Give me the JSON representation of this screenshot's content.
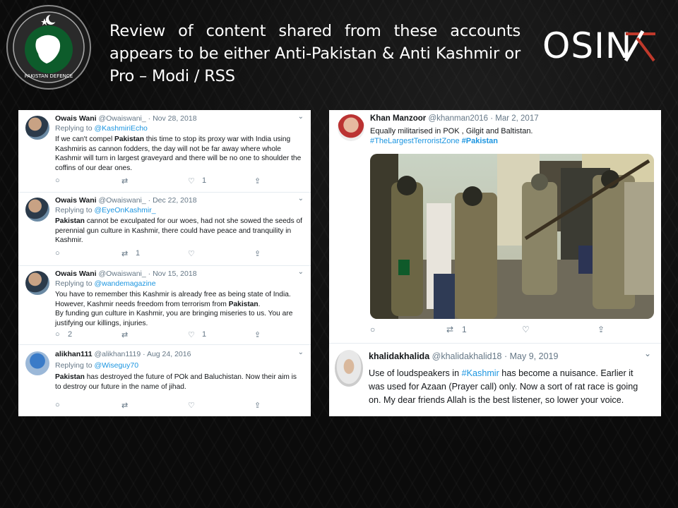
{
  "header": {
    "headline": "Review of content shared from these accounts appears to be either Anti-Pakistan & Anti Kashmir or Pro – Modi / RSS",
    "logo_text": "PAKISTAN DEFENCE",
    "brand": "OSIN"
  },
  "left_tweets": [
    {
      "name": "Owais Wani",
      "handle": "@Owaiswani_",
      "date": "· Nov 28, 2018",
      "replying_label": "Replying to",
      "replying_to": "@KashmiriEcho",
      "text_html": "If we can't compel <b>Pakistan</b> this time to stop its proxy war with India using Kashmiris as cannon fodders, the day will not be far away where whole Kashmir will turn in largest graveyard and there will be no one to shoulder the coffins of our dear ones.",
      "retweets": "",
      "likes": "1"
    },
    {
      "name": "Owais Wani",
      "handle": "@Owaiswani_",
      "date": "· Dec 22, 2018",
      "replying_label": "Replying to",
      "replying_to": "@EyeOnKashmir_",
      "text_html": "<b>Pakistan</b> cannot be exculpated for our woes, had not she sowed the seeds of perennial gun culture in Kashmir, there could have peace and tranquility in Kashmir.",
      "retweets": "1",
      "likes": ""
    },
    {
      "name": "Owais Wani",
      "handle": "@Owaiswani_",
      "date": "· Nov 15, 2018",
      "replying_label": "Replying to",
      "replying_to": "@wandemagazine",
      "text_html": "You have to remember this Kashmir is already free as being state of India. However, Kashmir needs freedom from terrorism from <b>Pakistan</b>.<br>By funding gun culture in Kashmir, you are bringing miseries to us. You are justifying our killings, injuries.",
      "replies": "2",
      "retweets": "",
      "likes": "1"
    },
    {
      "name": "alikhan111",
      "handle": "@alikhan1119",
      "date": "· Aug 24, 2016",
      "replying_label": "Replying to",
      "replying_to": "@Wiseguy70",
      "text_html": "<b>Pakistan</b> has destroyed the future of POk and Baluchistan. Now their aim is to destroy our future in the name of jihad.",
      "retweets": "",
      "likes": ""
    }
  ],
  "right_tweets": [
    {
      "name": "Khan Manzoor",
      "handle": "@khanman2016",
      "date": "· Mar 2, 2017",
      "text": "Equally militarised in POK , Gilgit and Baltistan.",
      "hashtag1": "#TheLargestTerroristZone",
      "hashtag2": "#Pakistan",
      "retweets": "1"
    },
    {
      "name": "khalidakhalida",
      "handle": "@khalidakhalid18",
      "date": "· May 9, 2019",
      "text_html": "Use of loudspeakers in <span style=\"color:#1b95e0\">#Kashmir</span> has become a nuisance. Earlier it was used for Azaan (Prayer call) only. Now a sort of rat race is going on. My dear friends Allah is the best listener, so lower your voice."
    }
  ],
  "icons": {
    "reply": "💬",
    "retweet": "⇄",
    "like": "♡",
    "share": "⇪",
    "chevron": "⌄"
  },
  "colors": {
    "link": "#1b95e0",
    "osint_accent": "#c0392b"
  }
}
